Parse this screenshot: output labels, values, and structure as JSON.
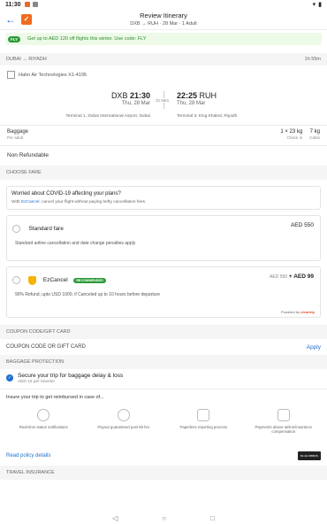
{
  "status": {
    "time": "11:30"
  },
  "header": {
    "title": "Review Itinerary",
    "subtitle": "DXB → RUH · 28 Mar · 1 Adult"
  },
  "promo": {
    "badge": "FLY",
    "text": "Get up to AED 120 off flights this winter. Use code: FLY"
  },
  "route": {
    "label": "DUBAI → RIYADH",
    "duration": "1h 55m"
  },
  "airline": {
    "name": "Hahn Air Technologies X1-4195"
  },
  "flight": {
    "dep_code": "DXB",
    "dep_time": "21:30",
    "dep_date": "Thu, 28 Mar",
    "dep_terminal": "Terminal 1, Dubai International Airport, Dubai",
    "arr_code": "RUH",
    "arr_time": "22:25",
    "arr_date": "Thu, 28 Mar",
    "arr_terminal": "Terminal 3, King Khaled, Riyadh",
    "stop": "1h 55m"
  },
  "baggage": {
    "label": "Baggage",
    "sub": "Per adult",
    "checkin": "1 × 23 kg",
    "checkin_label": "Check in",
    "cabin": "7 kg",
    "cabin_label": "Cabin"
  },
  "refund": "Non Refundable",
  "choose_fare": {
    "section": "CHOOSE FARE",
    "covid_title": "Worried about COVID-19 affecting your plans?",
    "covid_pre": "With ",
    "covid_link": "EzCancel",
    "covid_post": ", cancel your flight without paying hefty cancellation fees.",
    "standard": {
      "name": "Standard fare",
      "price": "AED 550",
      "desc": "Standard airline cancellation and date change penalties apply"
    },
    "ez": {
      "name": "EzCancel",
      "badge": "RECOMMENDED",
      "old_price": "AED 550",
      "add": "+ AED 99",
      "desc": "90% Refund, upto USD 1000, if Canceled up to 10 hours before departure",
      "powered_pre": "Powered by ",
      "powered_brand": "cleartrip"
    }
  },
  "coupon": {
    "section": "COUPON CODE/GIFT CARD",
    "placeholder": "COUPON CODE OR GIFT CARD",
    "apply": "Apply"
  },
  "baggage_protection": {
    "section": "BAGGAGE PROTECTION",
    "title": "Secure your trip for baggage delay & loss",
    "sub": "AED 15 per traveler",
    "insure": "Insure your trip to get reimbursed in case of...",
    "benefits": [
      {
        "label": "Real-time status notifications",
        "icon": "clock-icon"
      },
      {
        "label": "Payout guaranteed post 96 hrs",
        "icon": "stopwatch-icon"
      },
      {
        "label": "Paperless reporting process",
        "icon": "document-icon"
      },
      {
        "label": "Payments above airline/insurance compensation",
        "icon": "wallet-icon"
      }
    ],
    "policy": "Read policy details",
    "tag": "BLUE RIBBON BAGS"
  },
  "travel_insurance": {
    "section": "TRAVEL INSURANCE"
  }
}
